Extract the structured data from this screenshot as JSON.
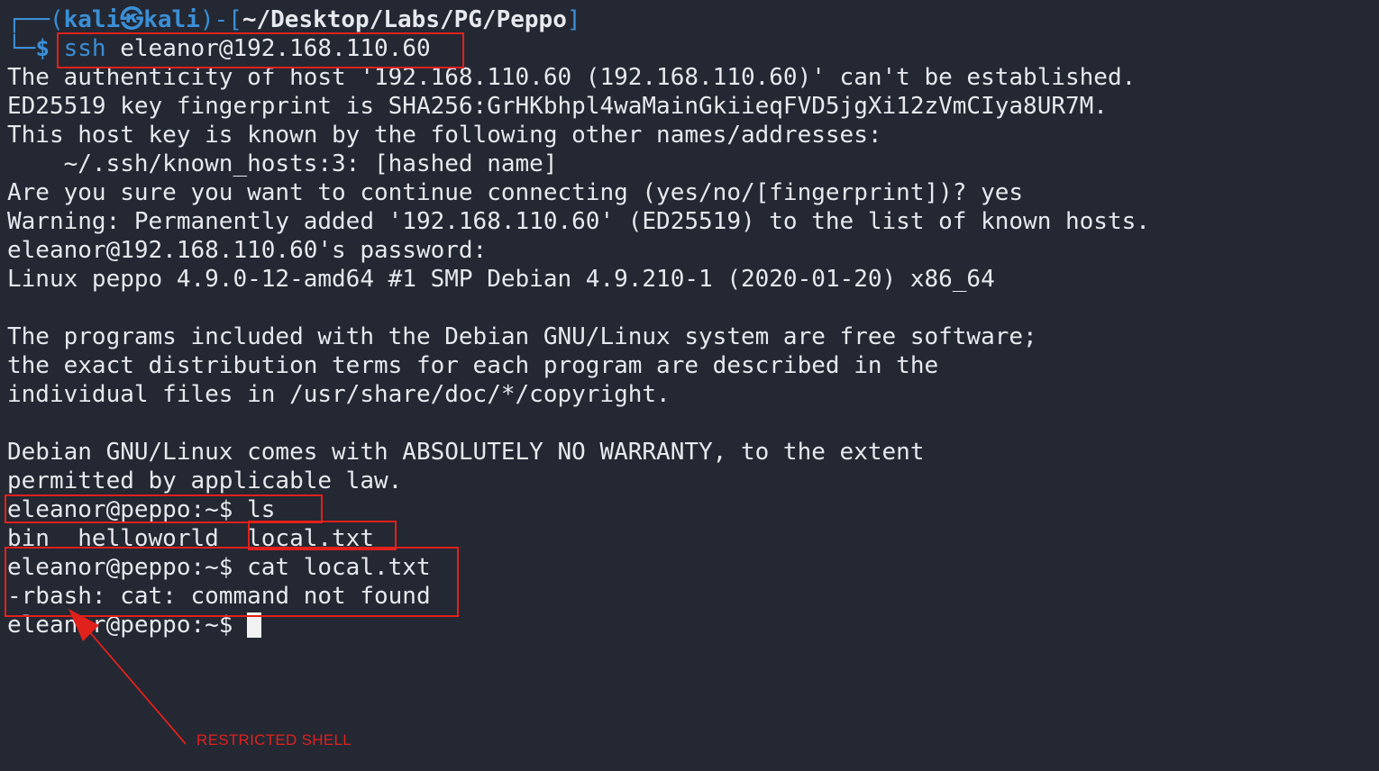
{
  "prompt": {
    "frame_top": "┌──",
    "frame_bottom": "└─",
    "open": "(",
    "user": "kali㉿kali",
    "close_open": ")-[",
    "path": "~/Desktop/Labs/PG/Peppo",
    "close": "]",
    "dollar": "$",
    "command_name": "ssh",
    "command_args": "eleanor@192.168.110.60"
  },
  "output_lines": [
    "The authenticity of host '192.168.110.60 (192.168.110.60)' can't be established.",
    "ED25519 key fingerprint is SHA256:GrHKbhpl4waMainGkiieqFVD5jgXi12zVmCIya8UR7M.",
    "This host key is known by the following other names/addresses:",
    "    ~/.ssh/known_hosts:3: [hashed name]",
    "Are you sure you want to continue connecting (yes/no/[fingerprint])? yes",
    "Warning: Permanently added '192.168.110.60' (ED25519) to the list of known hosts.",
    "eleanor@192.168.110.60's password:",
    "Linux peppo 4.9.0-12-amd64 #1 SMP Debian 4.9.210-1 (2020-01-20) x86_64",
    "",
    "The programs included with the Debian GNU/Linux system are free software;",
    "the exact distribution terms for each program are described in the",
    "individual files in /usr/share/doc/*/copyright.",
    "",
    "Debian GNU/Linux comes with ABSOLUTELY NO WARRANTY, to the extent",
    "permitted by applicable law.",
    "eleanor@peppo:~$ ls",
    "bin  helloworld  local.txt",
    "eleanor@peppo:~$ cat local.txt",
    "-rbash: cat: command not found",
    "eleanor@peppo:~$ "
  ],
  "annotation": {
    "label": "RESTRICTED SHELL",
    "color": "#e0211c"
  },
  "colors": {
    "background": "#242833",
    "text": "#e7e9ee",
    "prompt_blue": "#3b8fd6",
    "highlight_red": "#e0211c"
  }
}
